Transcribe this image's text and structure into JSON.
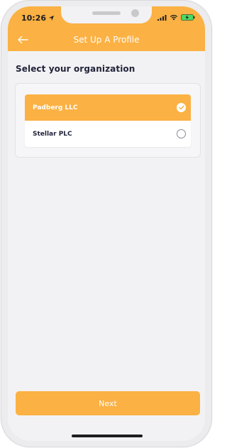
{
  "status_bar": {
    "time": "10:26",
    "icons": [
      "location-arrow-icon",
      "cellular-signal-icon",
      "wifi-icon",
      "battery-charging-icon"
    ]
  },
  "header": {
    "title": "Set Up A Profile",
    "back_icon": "arrow-left-icon"
  },
  "main": {
    "section_title": "Select your organization",
    "organizations": [
      {
        "label": "Padberg LLC",
        "selected": true
      },
      {
        "label": "Stellar PLC",
        "selected": false
      }
    ]
  },
  "footer": {
    "next_label": "Next"
  },
  "colors": {
    "accent": "#fbb143",
    "background": "#f2f2f4",
    "text_dark": "#22243a"
  }
}
